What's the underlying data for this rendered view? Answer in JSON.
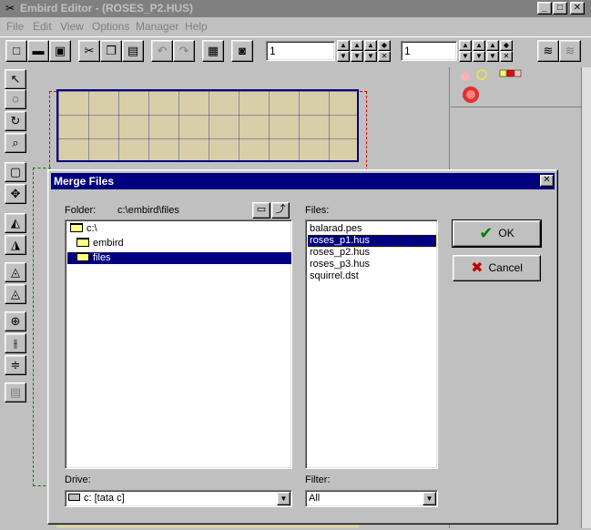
{
  "app": {
    "title": "Embird Editor - (ROSES_P2.HUS)",
    "minimize": "_",
    "maximize": "□",
    "close": "✕"
  },
  "menu": {
    "file": "File",
    "edit": "Edit",
    "view": "View",
    "options": "Options",
    "manager": "Manager",
    "help": "Help"
  },
  "toolbar": {
    "spin1_value": "1",
    "spin2_value": "1"
  },
  "dialog": {
    "title": "Merge Files",
    "folder_label": "Folder:",
    "folder_path": "c:\\embird\\files",
    "files_label": "Files:",
    "directories": [
      "c:\\",
      "embird",
      "files"
    ],
    "files": [
      "balarad.pes",
      "roses_p1.hus",
      "roses_p2.hus",
      "roses_p3.hus",
      "squirrel.dst"
    ],
    "selected_file": "roses_p1.hus",
    "drive_label": "Drive:",
    "drive_value": "c: [tata c]",
    "filter_label": "Filter:",
    "filter_value": "All",
    "ok_label": "OK",
    "cancel_label": "Cancel"
  },
  "colors": {
    "title_active": "#000080",
    "title_inactive": "#808080",
    "face": "#c0c0c0",
    "canvas_fill": "#d8cfa8"
  }
}
